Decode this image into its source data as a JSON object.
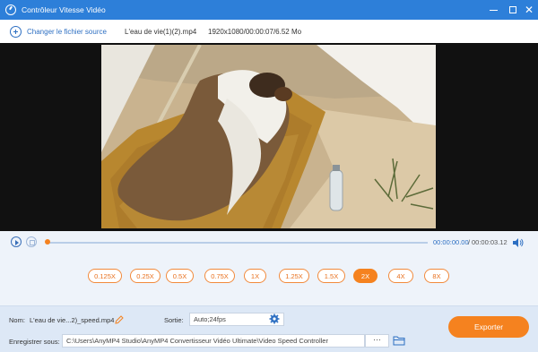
{
  "window": {
    "title": "Contrôleur Vitesse Vidéo",
    "icon": "app-speed-icon",
    "buttons": [
      "minimize-icon",
      "maximize-icon",
      "close-icon"
    ]
  },
  "toolbar": {
    "add_source_label": "Changer le fichier source",
    "file_name": "L'eau de vie(1)(2).mp4",
    "file_info": "1920x1080/00:00:07/6.52 Mo"
  },
  "player": {
    "current_time": "00:00:00.00",
    "separator": "/",
    "total_time": "00:00:03.12",
    "progress": 0
  },
  "speeds": {
    "options": [
      "0.125X",
      "0.25X",
      "0.5X",
      "0.75X",
      "1X",
      "1.25X",
      "1.5X",
      "2X",
      "4X",
      "8X"
    ],
    "selected": "2X"
  },
  "footer": {
    "name_label": "Nom:",
    "name_value": "L'eau de vie...2)_speed.mp4",
    "sortie_label": "Sortie:",
    "sortie_value": "Auto;24fps",
    "save_label": "Enregistrer sous:",
    "save_path": "C:\\Users\\AnyMP4 Studio\\AnyMP4 Convertisseur Vidéo Ultimate\\Video Speed Controller",
    "browse_label": "···",
    "export_label": "Exporter"
  },
  "colors": {
    "titlebar": "#2d7fd9",
    "accent": "#f5821f",
    "link": "#2d6fc2"
  }
}
